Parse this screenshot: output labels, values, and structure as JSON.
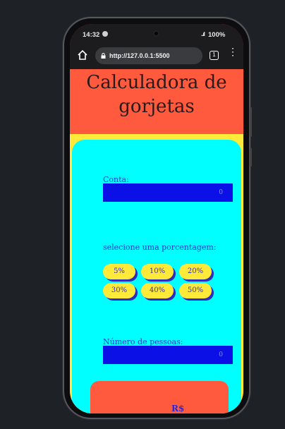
{
  "statusbar": {
    "time": "14:32",
    "battery": "100%",
    "signal": "..ıl"
  },
  "browser": {
    "url": "http://127.0.0.1:5500",
    "tab_count": "1",
    "menu_glyph": "⋮"
  },
  "app": {
    "title": "Calculadora de gorjetas",
    "bill": {
      "label": "Conta:",
      "value": "0"
    },
    "percent": {
      "label": "selecione uma porcentagem:",
      "options": [
        "5%",
        "10%",
        "20%",
        "30%",
        "40%",
        "50%"
      ]
    },
    "people": {
      "label": "Número de pessoas:",
      "value": "0"
    },
    "result": {
      "text": "R$"
    }
  },
  "colors": {
    "header": "#ff5a3d",
    "page_bg": "#ffea3a",
    "card_bg": "#00ffff",
    "input_bg": "#0a10e6",
    "accent_text": "#1a3bd6"
  }
}
